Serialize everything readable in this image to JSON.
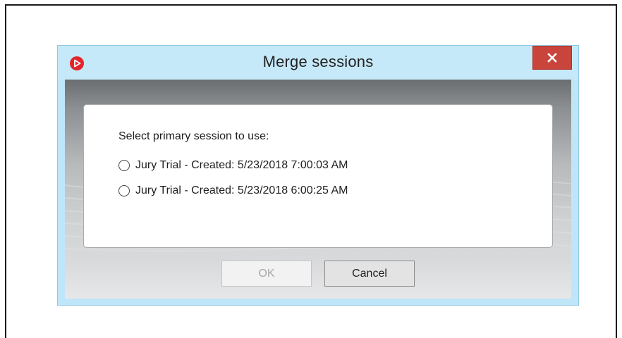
{
  "dialog": {
    "title": "Merge sessions",
    "app_icon": "app-logo-icon",
    "close_icon": "close-icon",
    "prompt": "Select primary session to use:",
    "options": [
      {
        "label": "Jury Trial - Created: 5/23/2018 7:00:03 AM",
        "selected": false
      },
      {
        "label": "Jury Trial - Created: 5/23/2018 6:00:25 AM",
        "selected": false
      }
    ],
    "buttons": {
      "ok_label": "OK",
      "ok_enabled": false,
      "cancel_label": "Cancel"
    }
  },
  "colors": {
    "titlebar": "#c6e9f9",
    "close_button": "#c9443b",
    "app_icon": "#e0262b",
    "disabled_text": "#a8a8a8"
  }
}
